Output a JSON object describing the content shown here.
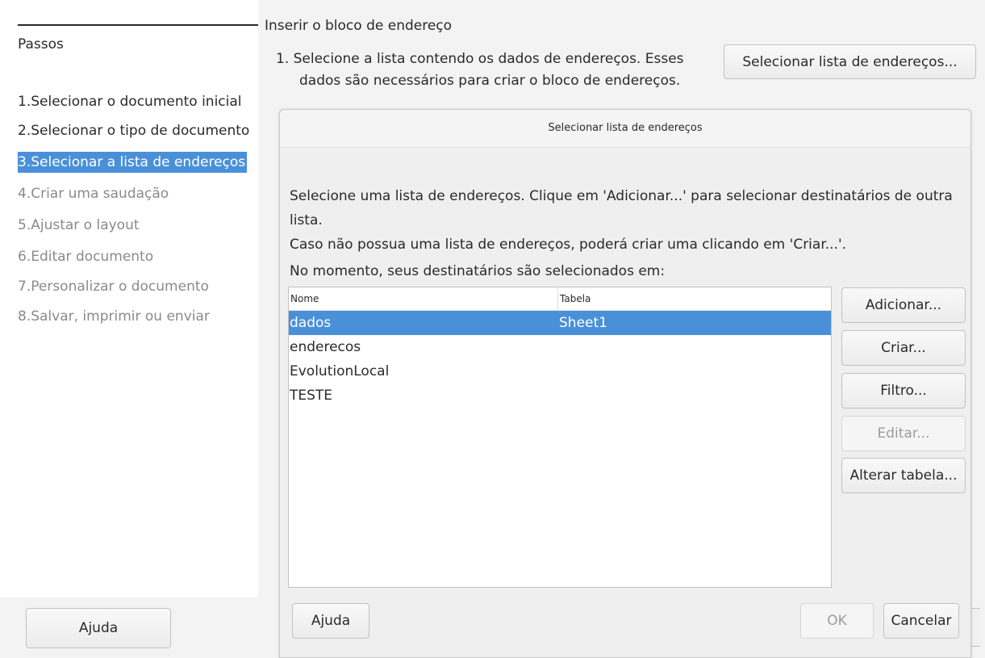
{
  "wizard": {
    "steps_title": "Passos",
    "steps": [
      {
        "label": "1.Selecionar o documento inicial",
        "state": "done"
      },
      {
        "label": "2.Selecionar o tipo de documento",
        "state": "done"
      },
      {
        "label": "3.Selecionar a lista de endereços",
        "state": "active"
      },
      {
        "label": "4.Criar uma saudação",
        "state": "todo"
      },
      {
        "label": "5.Ajustar o layout",
        "state": "todo"
      },
      {
        "label": "6.Editar documento",
        "state": "todo"
      },
      {
        "label": "7.Personalizar o documento",
        "state": "todo"
      },
      {
        "label": "8.Salvar, imprimir ou enviar",
        "state": "todo"
      }
    ],
    "help_label": "Ajuda"
  },
  "main": {
    "title": "Inserir o bloco de endereço",
    "instruction_line1": "1.  Selecione a lista contendo os dados de endereços. Esses",
    "instruction_line2": "dados são necessários para criar o bloco de endereços.",
    "select_list_label": "Selecionar lista de endereços..."
  },
  "dialog": {
    "title": "Selecionar lista de endereços",
    "desc_line1": "Selecione uma lista de endereços. Clique em 'Adicionar...' para selecionar destinatários de outra lista.",
    "desc_line2": "Caso não possua uma lista de endereços, poderá criar uma clicando em 'Criar...'.",
    "current_label": "No momento, seus destinatários são selecionados em:",
    "columns": {
      "name": "Nome",
      "table": "Tabela"
    },
    "rows": [
      {
        "name": "dados",
        "table": "Sheet1",
        "selected": true
      },
      {
        "name": "enderecos",
        "table": "",
        "selected": false
      },
      {
        "name": "EvolutionLocal",
        "table": "",
        "selected": false
      },
      {
        "name": "TESTE",
        "table": "",
        "selected": false
      }
    ],
    "buttons": {
      "add": "Adicionar...",
      "create": "Criar...",
      "filter": "Filtro...",
      "edit": "Editar...",
      "change_table": "Alterar tabela...",
      "help": "Ajuda",
      "ok": "OK",
      "cancel": "Cancelar"
    }
  },
  "colors": {
    "selection": "#4a90d9",
    "disabled_text": "#9c9c9c"
  }
}
